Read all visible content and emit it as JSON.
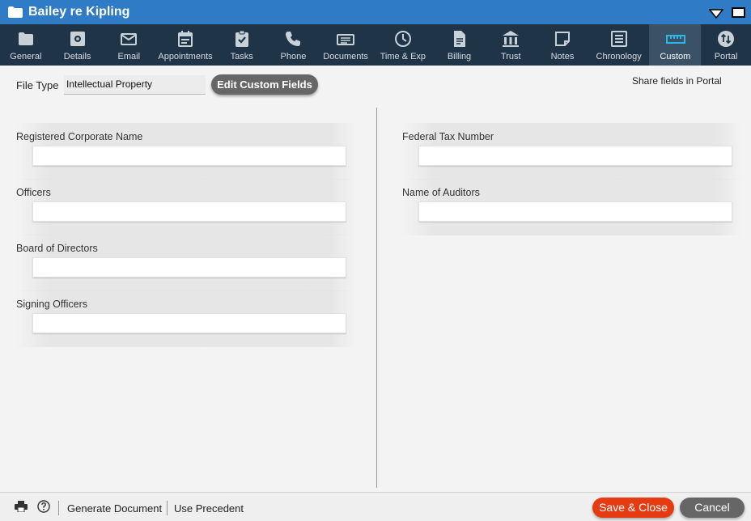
{
  "window": {
    "title": "Bailey re Kipling"
  },
  "tabs": [
    {
      "label": "General",
      "icon": "folder-icon"
    },
    {
      "label": "Details",
      "icon": "gear-doc-icon"
    },
    {
      "label": "Email",
      "icon": "envelope-icon"
    },
    {
      "label": "Appointments",
      "icon": "calendar-icon"
    },
    {
      "label": "Tasks",
      "icon": "clipboard-check-icon"
    },
    {
      "label": "Phone",
      "icon": "phone-icon"
    },
    {
      "label": "Documents",
      "icon": "documents-icon"
    },
    {
      "label": "Time & Exp",
      "icon": "clock-icon"
    },
    {
      "label": "Billing",
      "icon": "invoice-icon"
    },
    {
      "label": "Trust",
      "icon": "bank-icon"
    },
    {
      "label": "Notes",
      "icon": "note-icon"
    },
    {
      "label": "Chronology",
      "icon": "list-icon"
    },
    {
      "label": "Custom",
      "icon": "ruler-icon",
      "active": true
    },
    {
      "label": "Portal",
      "icon": "portal-icon"
    }
  ],
  "header": {
    "file_type_label": "File Type",
    "file_type_value": "Intellectual Property",
    "edit_button": "Edit Custom Fields",
    "share_label": "Share fields in Portal"
  },
  "left_fields": [
    {
      "label": "Registered Corporate Name",
      "value": ""
    },
    {
      "label": "Officers",
      "value": ""
    },
    {
      "label": "Board of Directors",
      "value": ""
    },
    {
      "label": "Signing Officers",
      "value": ""
    }
  ],
  "right_fields": [
    {
      "label": "Federal Tax Number",
      "value": ""
    },
    {
      "label": "Name of Auditors",
      "value": ""
    }
  ],
  "footer": {
    "generate_document": "Generate Document",
    "use_precedent": "Use Precedent",
    "save_close": "Save & Close",
    "cancel": "Cancel"
  },
  "colors": {
    "titlebar": "#2f7bc6",
    "toolbar": "#1f3447",
    "active_tab": "#3b5165",
    "accent": "#2fb6e8",
    "save_button": "#e63b12",
    "cancel_button": "#666666"
  }
}
